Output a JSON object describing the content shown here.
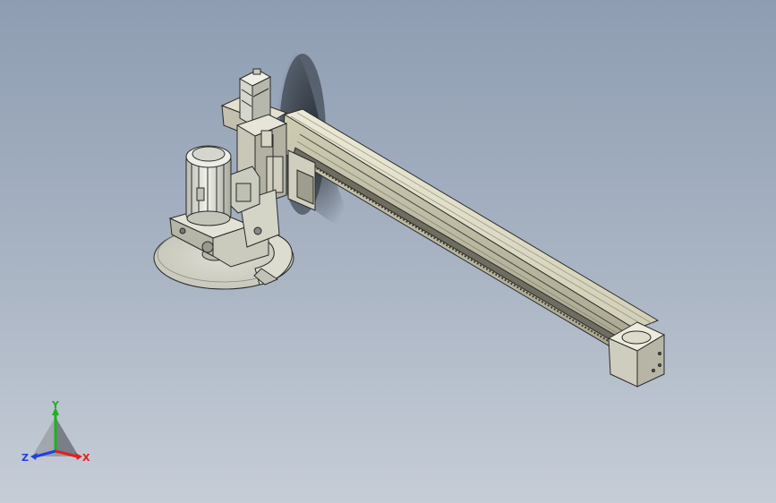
{
  "viewport": {
    "background_top": "#8e9db2",
    "background_bottom": "#c6cdd7"
  },
  "model": {
    "parts": [
      "linear-rail-beam",
      "rail-end-cap",
      "carriage-block",
      "servo-motor-vertical",
      "spindle-motor",
      "motor-mount-bracket",
      "saw-blade",
      "blade-guard"
    ],
    "colors": {
      "rail": "#dedbc4",
      "rail_shadow": "#8f8c78",
      "motor": "#d9dbd0",
      "edge": "#2a2a2a",
      "cast_shadow": "#2b2f38"
    }
  },
  "triad": {
    "x_label": "X",
    "y_label": "Y",
    "z_label": "Z",
    "x_color": "#e02020",
    "y_color": "#20b020",
    "z_color": "#2040e0"
  }
}
